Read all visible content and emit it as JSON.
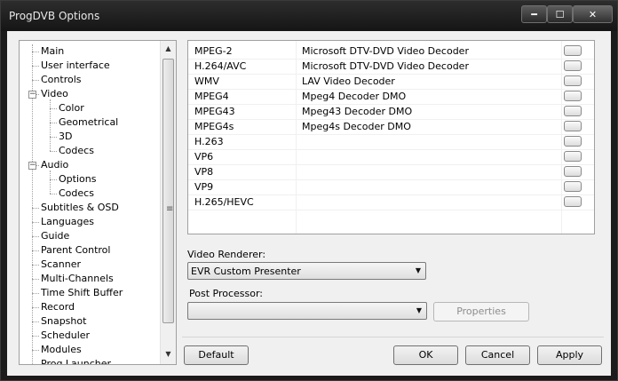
{
  "window": {
    "title": "ProgDVB Options"
  },
  "titlebar_buttons": {
    "minimize": "━",
    "maximize": "☐",
    "close": "✕"
  },
  "tree": {
    "items": [
      "Main",
      "User interface",
      "Controls",
      "Video",
      "Color",
      "Geometrical",
      "3D",
      "Codecs",
      "Audio",
      "Options",
      "Codecs",
      "Subtitles & OSD",
      "Languages",
      "Guide",
      "Parent Control",
      "Scanner",
      "Multi-Channels",
      "Time Shift Buffer",
      "Record",
      "Snapshot",
      "Scheduler",
      "Modules",
      "Prog.Launcher"
    ],
    "selected": "Codecs",
    "toggle_minus": "−"
  },
  "codecs": [
    {
      "name": "MPEG-2",
      "decoder": "Microsoft DTV-DVD Video Decoder"
    },
    {
      "name": "H.264/AVC",
      "decoder": "Microsoft DTV-DVD Video Decoder"
    },
    {
      "name": "WMV",
      "decoder": "LAV Video Decoder"
    },
    {
      "name": "MPEG4",
      "decoder": "Mpeg4 Decoder DMO"
    },
    {
      "name": "MPEG43",
      "decoder": "Mpeg43 Decoder DMO"
    },
    {
      "name": "MPEG4s",
      "decoder": "Mpeg4s Decoder DMO"
    },
    {
      "name": "H.263",
      "decoder": ""
    },
    {
      "name": "VP6",
      "decoder": ""
    },
    {
      "name": "VP8",
      "decoder": ""
    },
    {
      "name": "VP9",
      "decoder": ""
    },
    {
      "name": "H.265/HEVC",
      "decoder": ""
    }
  ],
  "video_renderer": {
    "label": "Video Renderer:",
    "value": "EVR Custom Presenter"
  },
  "post_processor": {
    "label": "Post Processor:",
    "value": ""
  },
  "buttons": {
    "properties": "Properties",
    "default": "Default",
    "ok": "OK",
    "cancel": "Cancel",
    "apply": "Apply"
  },
  "scroll": {
    "up": "▲",
    "down": "▼",
    "grip": "≡"
  },
  "combo_arrow": "▼"
}
